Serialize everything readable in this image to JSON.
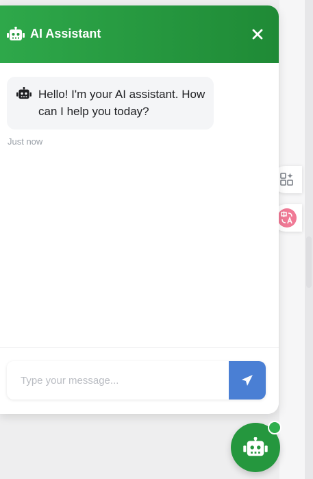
{
  "header": {
    "title": "AI Assistant",
    "icon": "robot-icon",
    "close_icon": "close-icon",
    "gradient_start": "#2ea84a",
    "gradient_end": "#1f8a36"
  },
  "messages": [
    {
      "sender": "assistant",
      "text": "Hello! I'm your AI assistant. How can I help you today?",
      "time": "Just now",
      "icon": "robot-icon"
    }
  ],
  "composer": {
    "placeholder": "Type your message...",
    "value": "",
    "send_icon": "paper-plane-icon",
    "send_color": "#4a7fd4"
  },
  "side_tools": [
    {
      "icon": "grid-sparkle-icon"
    },
    {
      "icon": "translate-icon",
      "color": "#f07a96"
    }
  ],
  "launcher": {
    "icon": "robot-icon",
    "color": "#25973e",
    "status": "online"
  }
}
